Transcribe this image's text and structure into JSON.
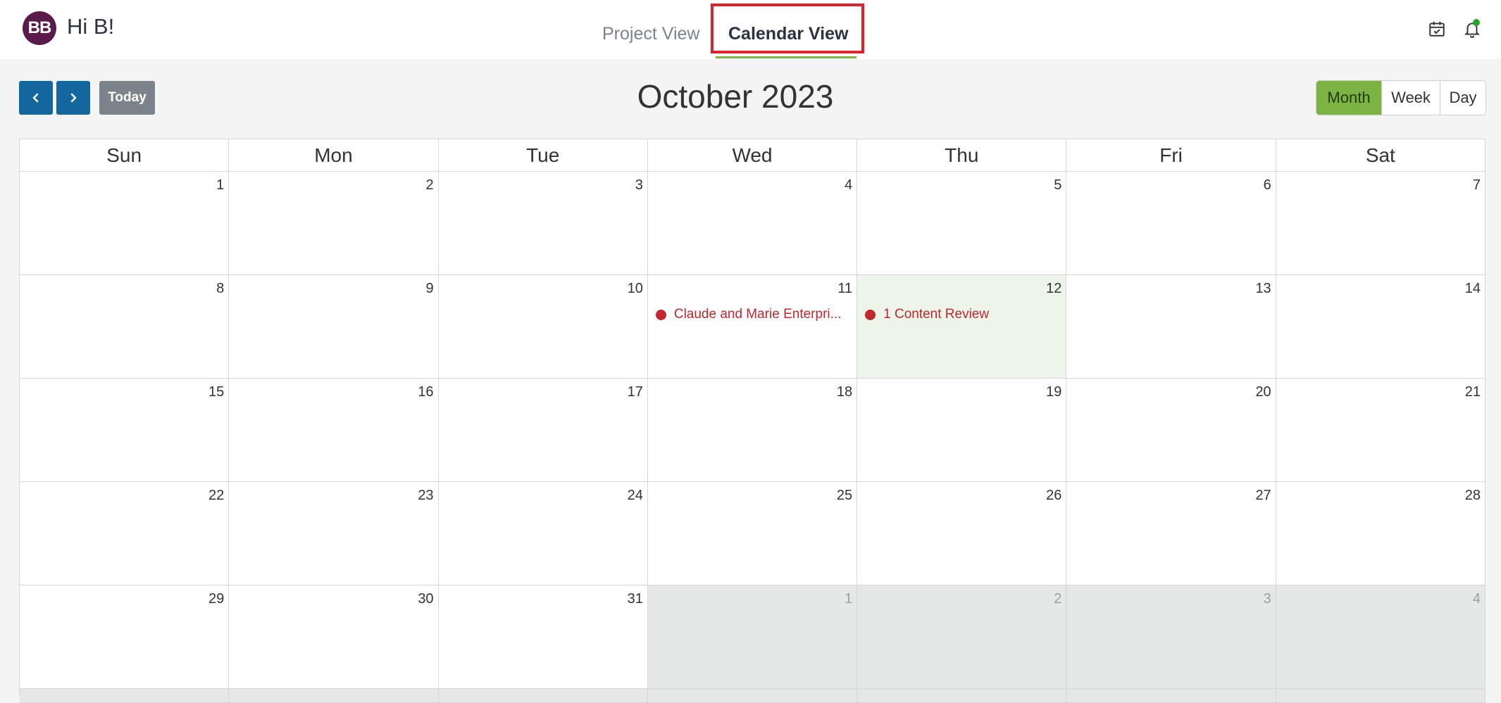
{
  "header": {
    "avatar_initials": "BB",
    "greeting": "Hi B!",
    "tabs": [
      {
        "label": "Project View",
        "active": false
      },
      {
        "label": "Calendar View",
        "active": true
      }
    ],
    "icons": [
      "calendar-check-icon",
      "bell-icon"
    ]
  },
  "toolbar": {
    "prev_icon": "chevron-left-icon",
    "next_icon": "chevron-right-icon",
    "today_label": "Today",
    "title": "October 2023",
    "views": [
      {
        "label": "Month",
        "active": true
      },
      {
        "label": "Week",
        "active": false
      },
      {
        "label": "Day",
        "active": false
      }
    ]
  },
  "calendar": {
    "weekdays": [
      "Sun",
      "Mon",
      "Tue",
      "Wed",
      "Thu",
      "Fri",
      "Sat"
    ],
    "weeks": [
      [
        {
          "day": "1"
        },
        {
          "day": "2"
        },
        {
          "day": "3"
        },
        {
          "day": "4"
        },
        {
          "day": "5"
        },
        {
          "day": "6"
        },
        {
          "day": "7"
        }
      ],
      [
        {
          "day": "8"
        },
        {
          "day": "9"
        },
        {
          "day": "10"
        },
        {
          "day": "11",
          "event": "Claude and Marie Enterpri..."
        },
        {
          "day": "12",
          "today": true,
          "event": "1 Content Review"
        },
        {
          "day": "13"
        },
        {
          "day": "14"
        }
      ],
      [
        {
          "day": "15"
        },
        {
          "day": "16"
        },
        {
          "day": "17"
        },
        {
          "day": "18"
        },
        {
          "day": "19"
        },
        {
          "day": "20"
        },
        {
          "day": "21"
        }
      ],
      [
        {
          "day": "22"
        },
        {
          "day": "23"
        },
        {
          "day": "24"
        },
        {
          "day": "25"
        },
        {
          "day": "26"
        },
        {
          "day": "27"
        },
        {
          "day": "28"
        }
      ],
      [
        {
          "day": "29"
        },
        {
          "day": "30"
        },
        {
          "day": "31"
        },
        {
          "day": "1",
          "other": true
        },
        {
          "day": "2",
          "other": true
        },
        {
          "day": "3",
          "other": true
        },
        {
          "day": "4",
          "other": true
        }
      ],
      [
        {
          "day": "",
          "other": true
        },
        {
          "day": "",
          "other": true
        },
        {
          "day": "",
          "other": true
        },
        {
          "day": "",
          "other": true
        },
        {
          "day": "",
          "other": true
        },
        {
          "day": "",
          "other": true
        },
        {
          "day": "",
          "other": true
        }
      ]
    ]
  },
  "colors": {
    "primary": "#12679e",
    "accent_green": "#7cb342",
    "event_red": "#c1272d",
    "highlight_red": "#e0212a",
    "today_bg": "#edf5eb"
  }
}
